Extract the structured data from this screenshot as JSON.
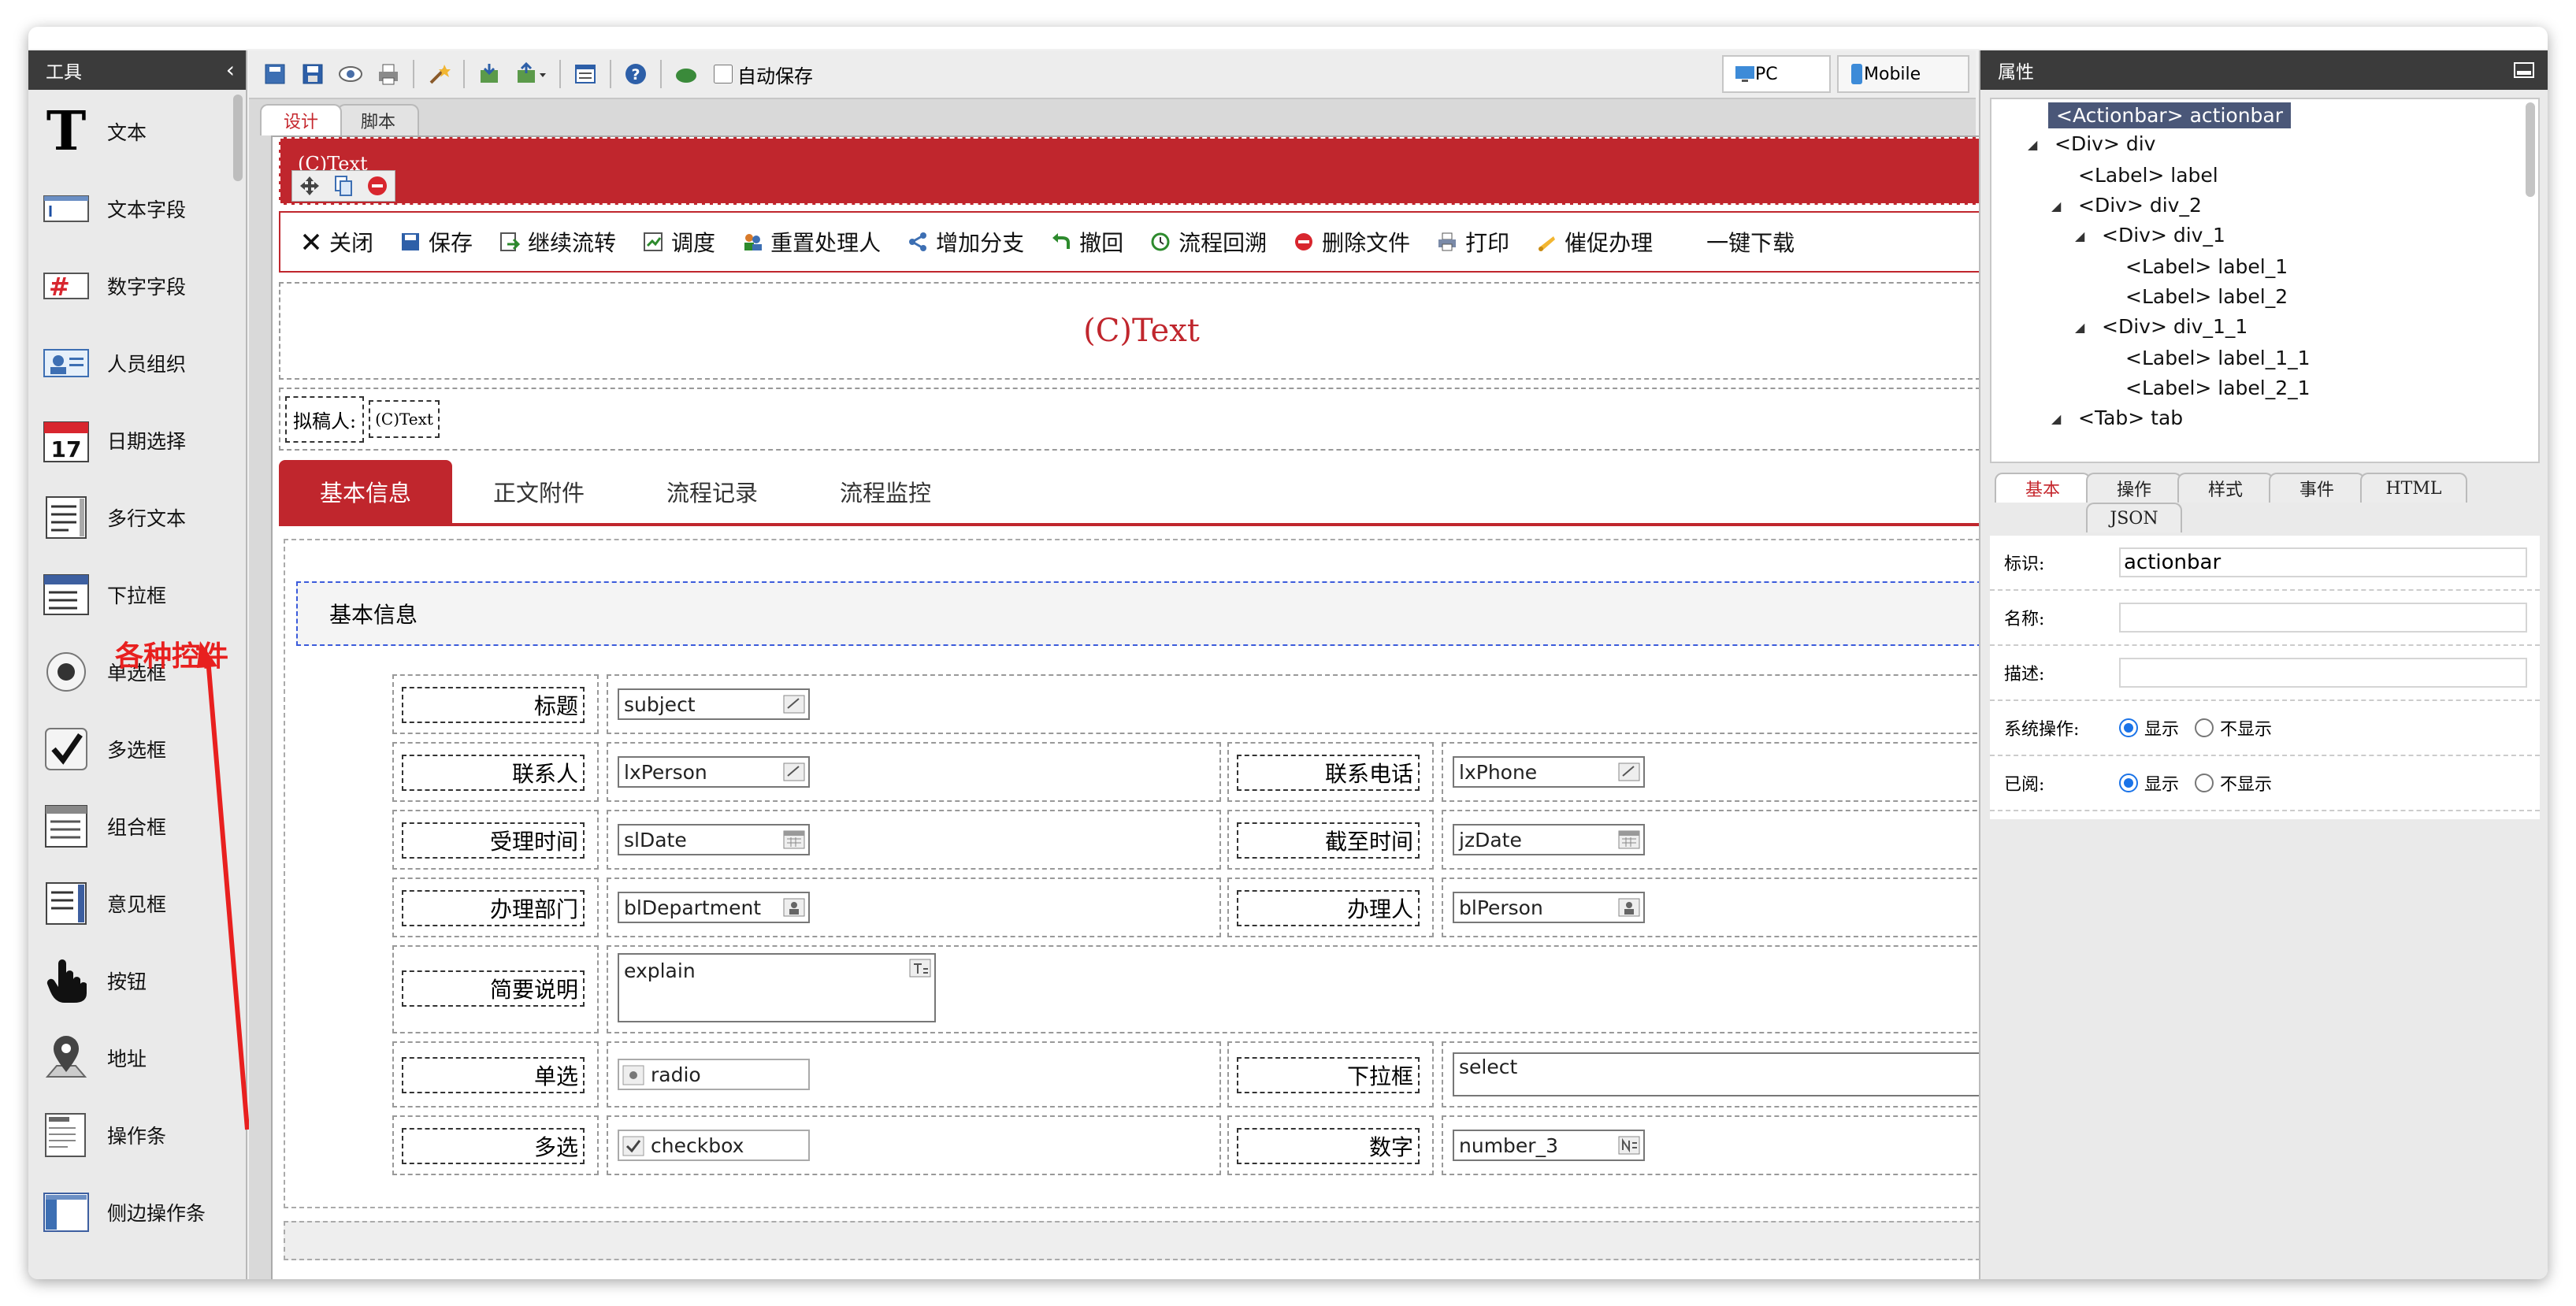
{
  "left_panel": {
    "title": "工具",
    "tools": [
      {
        "label": "文本",
        "icon": "text-tool-icon"
      },
      {
        "label": "文本字段",
        "icon": "textfield-tool-icon"
      },
      {
        "label": "数字字段",
        "icon": "number-field-tool-icon"
      },
      {
        "label": "人员组织",
        "icon": "person-org-tool-icon"
      },
      {
        "label": "日期选择",
        "icon": "calendar-tool-icon"
      },
      {
        "label": "多行文本",
        "icon": "textarea-tool-icon"
      },
      {
        "label": "下拉框",
        "icon": "dropdown-tool-icon"
      },
      {
        "label": "单选框",
        "icon": "radio-tool-icon"
      },
      {
        "label": "多选框",
        "icon": "checkbox-tool-icon"
      },
      {
        "label": "组合框",
        "icon": "combobox-tool-icon"
      },
      {
        "label": "意见框",
        "icon": "opinion-tool-icon"
      },
      {
        "label": "按钮",
        "icon": "hand-pointer-icon"
      },
      {
        "label": "地址",
        "icon": "map-pin-icon"
      },
      {
        "label": "操作条",
        "icon": "actionbar-tool-icon"
      },
      {
        "label": "侧边操作条",
        "icon": "side-actionbar-tool-icon"
      }
    ],
    "annotation": "各种控件",
    "calendar_day": "17",
    "number_glyph": "#"
  },
  "toolbar": {
    "autosave_label": "自动保存",
    "views": [
      {
        "label": "PC"
      },
      {
        "label": "Mobile"
      }
    ]
  },
  "editor_tabs": [
    "设计",
    "脚本"
  ],
  "form": {
    "header_text": "(C)Text",
    "actions": [
      "关闭",
      "保存",
      "继续流转",
      "调度",
      "重置处理人",
      "增加分支",
      "撤回",
      "流程回溯",
      "删除文件",
      "打印",
      "催促办理",
      "一键下载"
    ],
    "title_text": "(C)Text",
    "drafter_label": "拟稿人:",
    "drafter_value": "(C)Text",
    "tabs": [
      "基本信息",
      "正文附件",
      "流程记录",
      "流程监控"
    ],
    "section_title": "基本信息",
    "fields": {
      "subject": {
        "label": "标题",
        "value": "subject"
      },
      "lxPerson": {
        "label": "联系人",
        "value": "lxPerson"
      },
      "lxPhone": {
        "label": "联系电话",
        "value": "lxPhone"
      },
      "slDate": {
        "label": "受理时间",
        "value": "slDate"
      },
      "jzDate": {
        "label": "截至时间",
        "value": "jzDate"
      },
      "blDepartment": {
        "label": "办理部门",
        "value": "blDepartment"
      },
      "blPerson": {
        "label": "办理人",
        "value": "blPerson"
      },
      "explain": {
        "label": "简要说明",
        "value": "explain"
      },
      "radio": {
        "label": "单选",
        "value": "radio"
      },
      "select": {
        "label": "下拉框",
        "value": "select"
      },
      "checkbox": {
        "label": "多选",
        "value": "checkbox"
      },
      "number": {
        "label": "数字",
        "value": "number_3"
      }
    }
  },
  "right_panel": {
    "title": "属性",
    "tree": [
      {
        "text": "<Actionbar> actionbar",
        "depth": 0,
        "selected": true,
        "expander": false
      },
      {
        "text": "<Div> div",
        "depth": 0,
        "expander": true
      },
      {
        "text": "<Label> label",
        "depth": 1,
        "expander": false
      },
      {
        "text": "<Div> div_2",
        "depth": 1,
        "expander": true
      },
      {
        "text": "<Div> div_1",
        "depth": 2,
        "expander": true
      },
      {
        "text": "<Label> label_1",
        "depth": 3,
        "expander": false
      },
      {
        "text": "<Label> label_2",
        "depth": 3,
        "expander": false
      },
      {
        "text": "<Div> div_1_1",
        "depth": 2,
        "expander": true
      },
      {
        "text": "<Label> label_1_1",
        "depth": 3,
        "expander": false
      },
      {
        "text": "<Label> label_2_1",
        "depth": 3,
        "expander": false
      },
      {
        "text": "<Tab> tab",
        "depth": 1,
        "expander": true
      }
    ],
    "prop_tabs": [
      "基本",
      "操作",
      "样式",
      "事件",
      "HTML",
      "JSON"
    ],
    "props": {
      "id_label": "标识:",
      "id_value": "actionbar",
      "name_label": "名称:",
      "desc_label": "描述:",
      "sysop_label": "系统操作:",
      "read_label": "已阅:",
      "show": "显示",
      "hide": "不显示"
    }
  },
  "colors": {
    "accent_red": "#c0262d",
    "dark_header": "#3b3b3b",
    "selection": "#4a5778"
  }
}
